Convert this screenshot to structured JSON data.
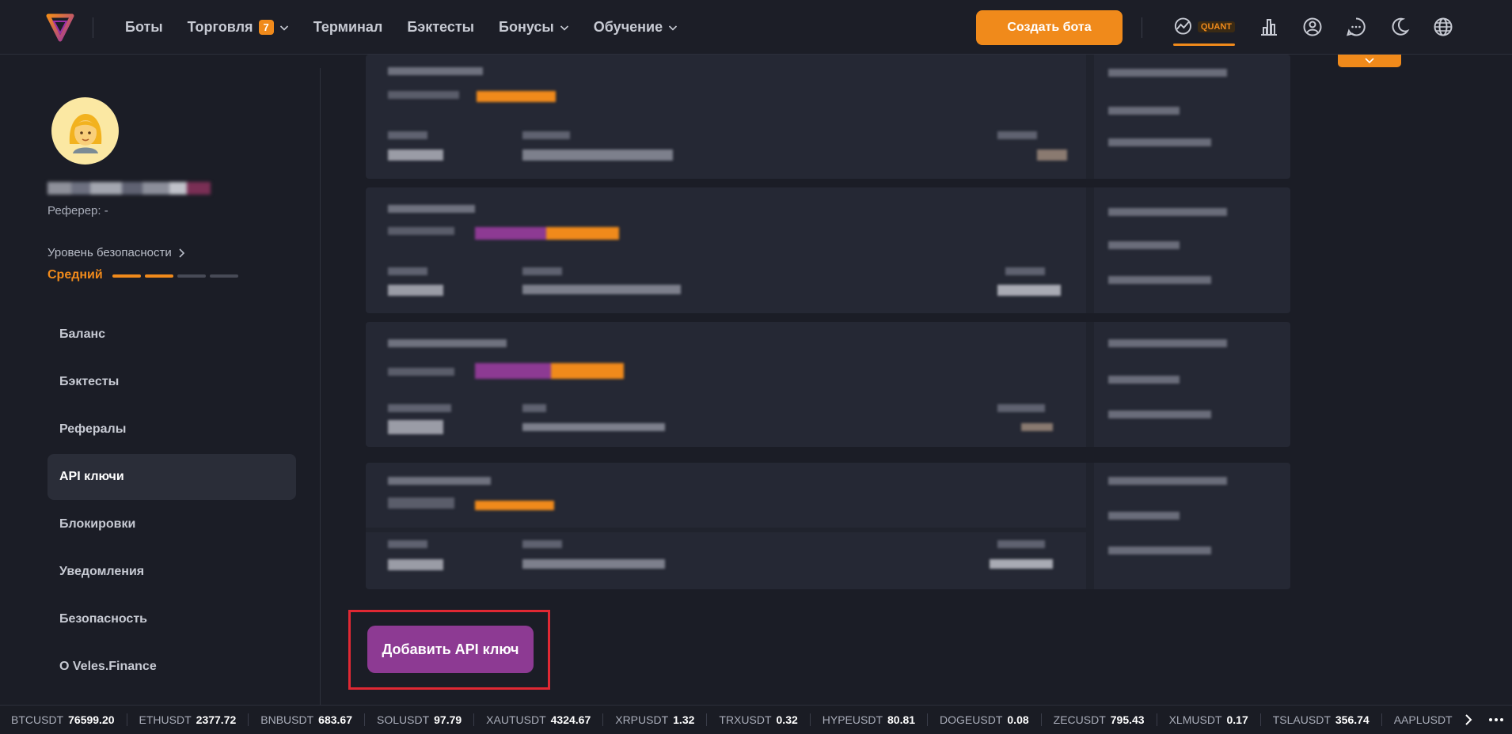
{
  "nav": {
    "items": [
      {
        "label": "Боты",
        "badge": null,
        "dropdown": false
      },
      {
        "label": "Торговля",
        "badge": "7",
        "dropdown": true
      },
      {
        "label": "Терминал",
        "badge": null,
        "dropdown": false
      },
      {
        "label": "Бэктесты",
        "badge": null,
        "dropdown": false
      },
      {
        "label": "Бонусы",
        "badge": null,
        "dropdown": true
      },
      {
        "label": "Обучение",
        "badge": null,
        "dropdown": true
      }
    ],
    "create_bot_label": "Создать бота",
    "quant_label": "QUANT"
  },
  "sidebar": {
    "referrer": "Реферер: -",
    "security_link": "Уровень безопасности",
    "security_level": "Средний",
    "security_level_filled": 2,
    "security_level_total": 4,
    "menu": [
      {
        "label": "Баланс",
        "active": false
      },
      {
        "label": "Бэктесты",
        "active": false
      },
      {
        "label": "Рефералы",
        "active": false
      },
      {
        "label": "API ключи",
        "active": true
      },
      {
        "label": "Блокировки",
        "active": false
      },
      {
        "label": "Уведомления",
        "active": false
      },
      {
        "label": "Безопасность",
        "active": false
      },
      {
        "label": "О Veles.Finance",
        "active": false
      }
    ]
  },
  "main": {
    "add_api_key_label": "Добавить API ключ"
  },
  "ticker": [
    {
      "symbol": "BTCUSDT",
      "price": "76599.20"
    },
    {
      "symbol": "ETHUSDT",
      "price": "2377.72"
    },
    {
      "symbol": "BNBUSDT",
      "price": "683.67"
    },
    {
      "symbol": "SOLUSDT",
      "price": "97.79"
    },
    {
      "symbol": "XAUTUSDT",
      "price": "4324.67"
    },
    {
      "symbol": "XRPUSDT",
      "price": "1.32"
    },
    {
      "symbol": "TRXUSDT",
      "price": "0.32"
    },
    {
      "symbol": "HYPEUSDT",
      "price": "80.81"
    },
    {
      "symbol": "DOGEUSDT",
      "price": "0.08"
    },
    {
      "symbol": "ZECUSDT",
      "price": "795.43"
    },
    {
      "symbol": "XLMUSDT",
      "price": "0.17"
    },
    {
      "symbol": "TSLAUSDT",
      "price": "356.74"
    },
    {
      "symbol": "AAPLUSDT",
      "price": ""
    }
  ],
  "colors": {
    "accent": "#f08a1b",
    "purple": "#8d3a93",
    "background": "#1b1d26",
    "highlight_frame": "#e02833"
  }
}
